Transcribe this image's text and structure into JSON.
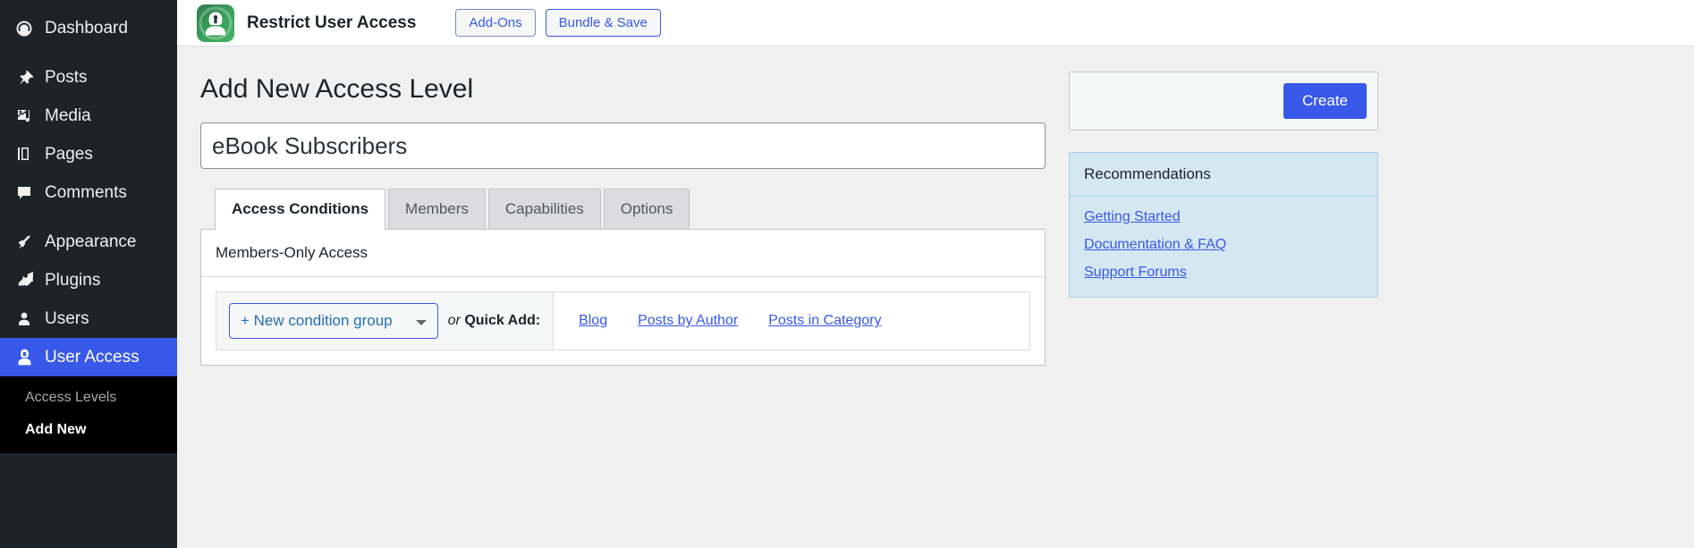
{
  "sidebar": {
    "items": [
      {
        "label": "Dashboard",
        "icon": "dashboard-icon",
        "current": false
      },
      {
        "label": "Posts",
        "icon": "pin-icon",
        "current": false
      },
      {
        "label": "Media",
        "icon": "media-icon",
        "current": false
      },
      {
        "label": "Pages",
        "icon": "pages-icon",
        "current": false
      },
      {
        "label": "Comments",
        "icon": "comments-icon",
        "current": false
      },
      {
        "label": "Appearance",
        "icon": "brush-icon",
        "current": false
      },
      {
        "label": "Plugins",
        "icon": "plug-icon",
        "current": false
      },
      {
        "label": "Users",
        "icon": "user-icon",
        "current": false
      },
      {
        "label": "User Access",
        "icon": "shield-user-icon",
        "current": true
      }
    ],
    "submenu": [
      {
        "label": "Access Levels",
        "current": false
      },
      {
        "label": "Add New",
        "current": true
      }
    ]
  },
  "header": {
    "logo_icon": "restrict-user-access-logo",
    "plugin_title": "Restrict User Access",
    "buttons": [
      {
        "label": "Add-Ons",
        "name": "add-ons-button"
      },
      {
        "label": "Bundle & Save",
        "name": "bundle-and-save-button"
      }
    ]
  },
  "main": {
    "page_title": "Add New Access Level",
    "title_input": {
      "value": "eBook Subscribers",
      "placeholder": "Enter title here"
    },
    "tabs": [
      {
        "label": "Access Conditions",
        "active": true
      },
      {
        "label": "Members",
        "active": false
      },
      {
        "label": "Capabilities",
        "active": false
      },
      {
        "label": "Options",
        "active": false
      }
    ],
    "panel": {
      "heading": "Members-Only Access",
      "new_group_label": "+ New condition group",
      "quick_add_or": "or",
      "quick_add_label": "Quick Add:",
      "quick_links": [
        "Blog",
        "Posts by Author",
        "Posts in Category"
      ]
    }
  },
  "aside": {
    "create_button": "Create",
    "recommendations": {
      "heading": "Recommendations",
      "links": [
        "Getting Started",
        "Documentation & FAQ",
        "Support Forums"
      ]
    }
  },
  "colors": {
    "accent_blue": "#3858e9",
    "sidebar_bg": "#1d2327",
    "link_blue": "#3858e9",
    "recommendations_bg": "#d5e8f2",
    "logo_green": "#3aa15c"
  }
}
